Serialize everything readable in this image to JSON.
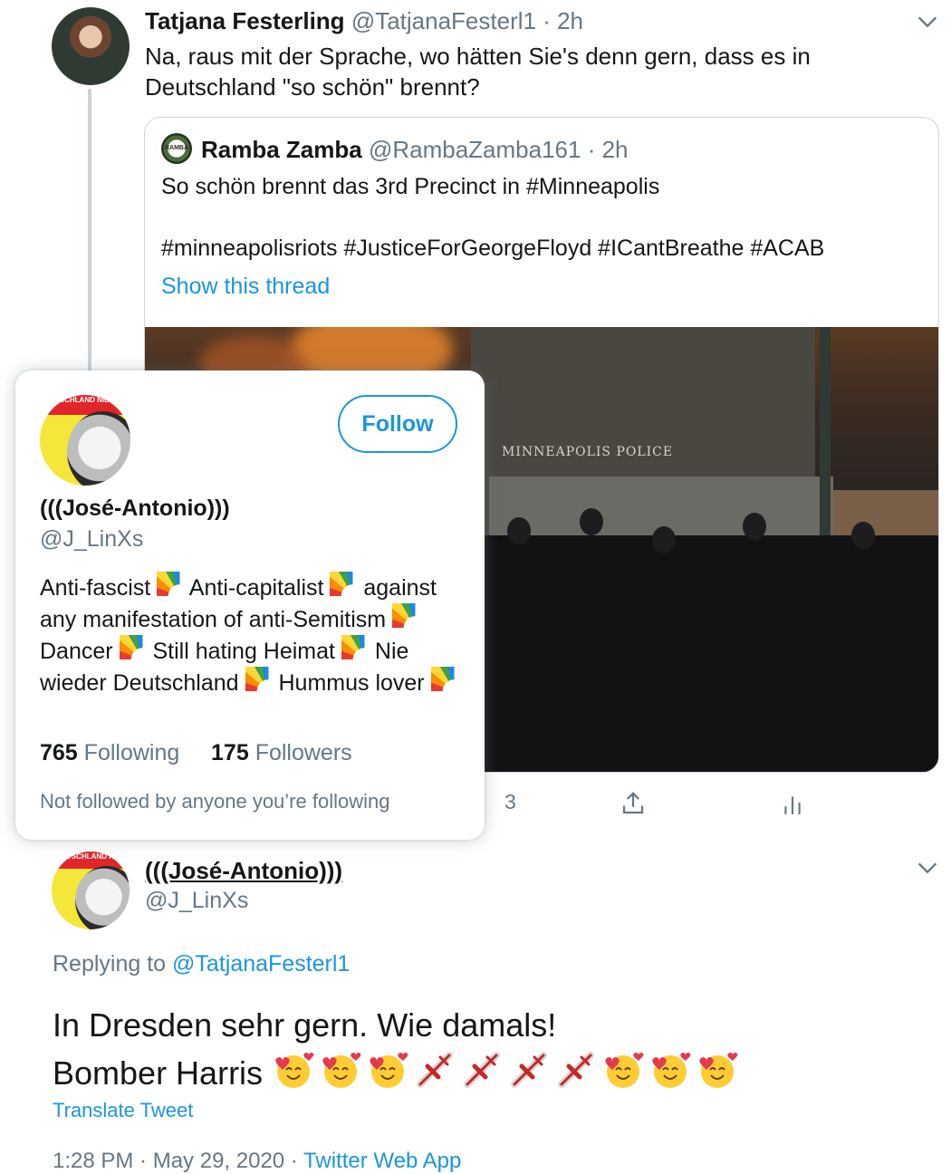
{
  "tweet1": {
    "name": "Tatjana Festerling",
    "handle": "@TatjanaFesterl1",
    "time": "· 2h",
    "text_line1": "Na, raus mit der Sprache, wo hätten Sie's denn gern, dass es in",
    "text_line2": "Deutschland \"so schön\" brennt?"
  },
  "quote": {
    "avatar_text": "RAMBA ZAMBA",
    "name": "Ramba Zamba",
    "handle": "@RambaZamba161",
    "time": "· 2h",
    "text": "So schön brennt das 3rd Precinct in #Minneapolis",
    "hashtags": "#minneapolisriots #JusticeForGeorgeFloyd #ICantBreathe #ACAB",
    "show_thread": "Show this thread",
    "photo_sign": "MINNEAPOLIS POLICE"
  },
  "actions": {
    "reply_count": "3"
  },
  "hover_card": {
    "avatar_banner": "DEUTSCHLAND NIE WIEDER!",
    "follow_label": "Follow",
    "name": "(((José-Antonio)))",
    "handle": "@J_LinXs",
    "bio": {
      "p1": "Anti-fascist",
      "p2": "Anti-capitalist",
      "p3": "against any manifestation of anti-Semitism",
      "p4": "Dancer",
      "p5": "Still hating Heimat",
      "p6": "Nie wieder Deutschland",
      "p7": "Hummus lover"
    },
    "following_count": "765",
    "following_label": "Following",
    "followers_count": "175",
    "followers_label": "Followers",
    "note": "Not followed by anyone you’re following"
  },
  "reply": {
    "avatar_banner": "DEUTSCHLAND NIE WIEDER!",
    "name": "(((José-Antonio)))",
    "handle": "@J_LinXs",
    "replying_prefix": "Replying to",
    "replying_handle": "@TatjanaFesterl1",
    "text_line1": "In Dresden sehr gern. Wie damals!",
    "text_line2": "Bomber Harris",
    "emoji_sequence": [
      "smiling-face-with-hearts",
      "smiling-face-with-hearts",
      "smiling-face-with-hearts",
      "airplane",
      "airplane",
      "airplane",
      "airplane",
      "smiling-face-with-hearts",
      "smiling-face-with-hearts",
      "smiling-face-with-hearts"
    ],
    "translate": "Translate Tweet",
    "timestamp": "1:28 PM · May 29, 2020 ·",
    "source": "Twitter Web App"
  },
  "colors": {
    "link": "#1b95e0",
    "muted": "#657786",
    "text": "#14171a",
    "border": "#ccd6dd"
  }
}
